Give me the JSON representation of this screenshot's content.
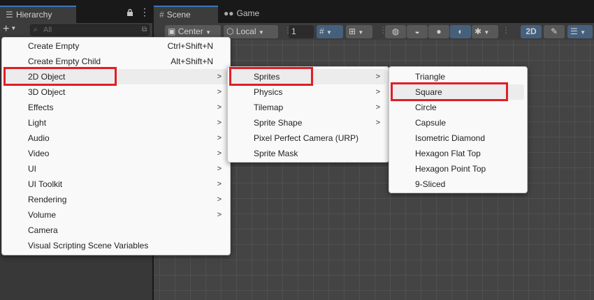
{
  "hierarchy": {
    "tab_label": "Hierarchy",
    "search_placeholder": "All"
  },
  "scene": {
    "tabs": [
      {
        "label": "Scene"
      },
      {
        "label": "Game"
      }
    ],
    "toolbar": {
      "pivot": "Center",
      "space": "Local",
      "snap_value": "1",
      "mode_2d": "2D"
    }
  },
  "menu1": {
    "items": [
      {
        "label": "Create Empty",
        "shortcut": "Ctrl+Shift+N"
      },
      {
        "label": "Create Empty Child",
        "shortcut": "Alt+Shift+N"
      },
      {
        "label": "2D Object"
      },
      {
        "label": "3D Object"
      },
      {
        "label": "Effects"
      },
      {
        "label": "Light"
      },
      {
        "label": "Audio"
      },
      {
        "label": "Video"
      },
      {
        "label": "UI"
      },
      {
        "label": "UI Toolkit"
      },
      {
        "label": "Rendering"
      },
      {
        "label": "Volume"
      },
      {
        "label": "Camera"
      },
      {
        "label": "Visual Scripting Scene Variables"
      }
    ]
  },
  "menu2": {
    "items": [
      {
        "label": "Sprites"
      },
      {
        "label": "Physics"
      },
      {
        "label": "Tilemap"
      },
      {
        "label": "Sprite Shape"
      },
      {
        "label": "Pixel Perfect Camera (URP)"
      },
      {
        "label": "Sprite Mask"
      }
    ]
  },
  "menu3": {
    "items": [
      {
        "label": "Triangle"
      },
      {
        "label": "Square"
      },
      {
        "label": "Circle"
      },
      {
        "label": "Capsule"
      },
      {
        "label": "Isometric Diamond"
      },
      {
        "label": "Hexagon Flat Top"
      },
      {
        "label": "Hexagon Point Top"
      },
      {
        "label": "9-Sliced"
      }
    ]
  },
  "colors": {
    "highlight_box": "#e01e26",
    "tab_accent": "#3a79bb"
  }
}
